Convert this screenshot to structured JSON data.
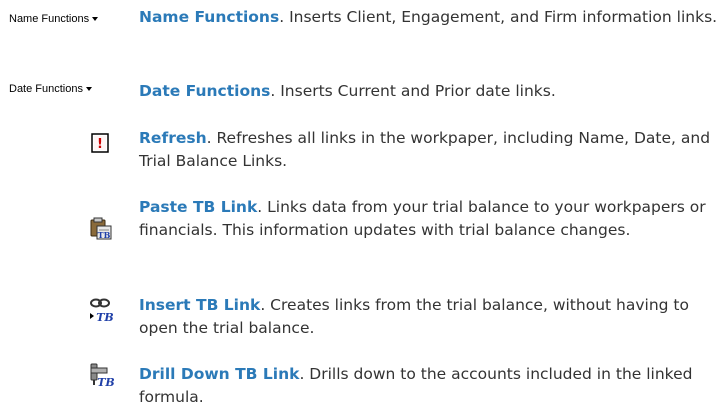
{
  "entries": [
    {
      "icon": "name-functions-dropdown",
      "control_label": "Name Functions",
      "term": "Name Functions",
      "sep": ".",
      "description": " Inserts Client, Engagement, and Firm information links."
    },
    {
      "icon": "date-functions-dropdown",
      "control_label": "Date Functions",
      "term": "Date Functions",
      "sep": ".",
      "description": " Inserts Current and Prior date links."
    },
    {
      "icon": "refresh-icon",
      "term": "Refresh",
      "sep": ".",
      "description": " Refreshes all links in the workpaper, including Name, Date, and Trial Balance Links."
    },
    {
      "icon": "paste-tb-link-icon",
      "term": "Paste TB Link",
      "sep": ".",
      "description": " Links data from your trial balance to your workpapers or financials. This information updates with trial balance changes."
    },
    {
      "icon": "insert-tb-link-icon",
      "term": "Insert TB Link",
      "sep": ".",
      "description": " Creates links from the trial balance, without having to open the trial balance."
    },
    {
      "icon": "drill-down-tb-link-icon",
      "term": "Drill Down TB Link",
      "sep": ".",
      "description": " Drills down to the accounts included in the linked formula."
    }
  ],
  "icon_glyphs": {
    "refresh": "!",
    "tb_tag": "TB"
  }
}
